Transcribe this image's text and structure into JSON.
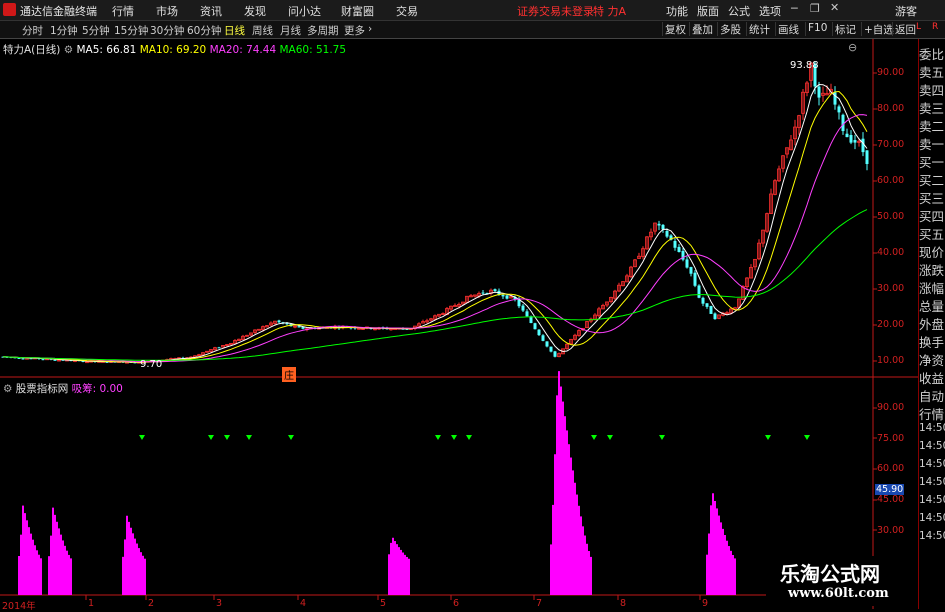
{
  "app": {
    "title": "通达信金融终端"
  },
  "menu": [
    "行情",
    "市场",
    "资讯",
    "发现",
    "问小达",
    "财富圈",
    "交易"
  ],
  "warning": "证券交易未登录",
  "stock_name": "特 力A",
  "menu_right": [
    "功能",
    "版面",
    "公式",
    "选项"
  ],
  "user": "游客",
  "toolbar": {
    "periods": [
      "分时",
      "1分钟",
      "5分钟",
      "15分钟",
      "30分钟",
      "60分钟",
      "日线",
      "周线",
      "月线",
      "多周期",
      "更多"
    ],
    "active": "日线",
    "right": [
      "复权",
      "叠加",
      "多股",
      "统计",
      "画线",
      "F10",
      "标记",
      "+自选",
      "返回"
    ]
  },
  "main_legend": {
    "title": "特力A(日线)",
    "ma": [
      {
        "label": "MA5: 66.81",
        "color": "#ffffff"
      },
      {
        "label": "MA10: 69.20",
        "color": "#ffff00"
      },
      {
        "label": "MA20: 74.44",
        "color": "#ff40ff"
      },
      {
        "label": "MA60: 51.75",
        "color": "#00ff00"
      }
    ]
  },
  "main_annotations": {
    "high": "93.88",
    "low": "9.70",
    "badge": "庄"
  },
  "main_axis": [
    "90.00",
    "80.00",
    "70.00",
    "60.00",
    "50.00",
    "40.00",
    "30.00",
    "20.00",
    "10.00"
  ],
  "sub_legend": {
    "title": "股票指标网",
    "item": "吸筹: 0.00",
    "item_color": "#ff40ff"
  },
  "sub_axis": [
    "90.00",
    "75.00",
    "60.00",
    "45.00",
    "30.00"
  ],
  "sub_current": "45.90",
  "x_axis": [
    "2014年",
    "1",
    "2",
    "3",
    "4",
    "5",
    "6",
    "7",
    "8",
    "9"
  ],
  "right_panel": [
    "委比",
    "卖五",
    "卖四",
    "卖三",
    "卖二",
    "卖一",
    "买一",
    "买二",
    "买三",
    "买四",
    "买五",
    "现价",
    "涨跌",
    "涨幅",
    "总量",
    "外盘",
    "换手",
    "净资",
    "收益",
    "自动",
    "行情",
    "14:50",
    "14:50",
    "14:50",
    "14:50",
    "14:50",
    "14:50",
    "14:50"
  ],
  "right_top": {
    "l": "L",
    "r": "R"
  },
  "watermark": {
    "line1": "乐淘公式网",
    "line2": "www.60lt.com"
  },
  "colors": {
    "up": "#ff3030",
    "down": "#54ffff",
    "ma5": "#ffffff",
    "ma10": "#ffff00",
    "ma20": "#ff40ff",
    "ma60": "#00ff00",
    "bar": "#ff00ff",
    "marker": "#00ff00",
    "axis": "#c01818"
  }
}
